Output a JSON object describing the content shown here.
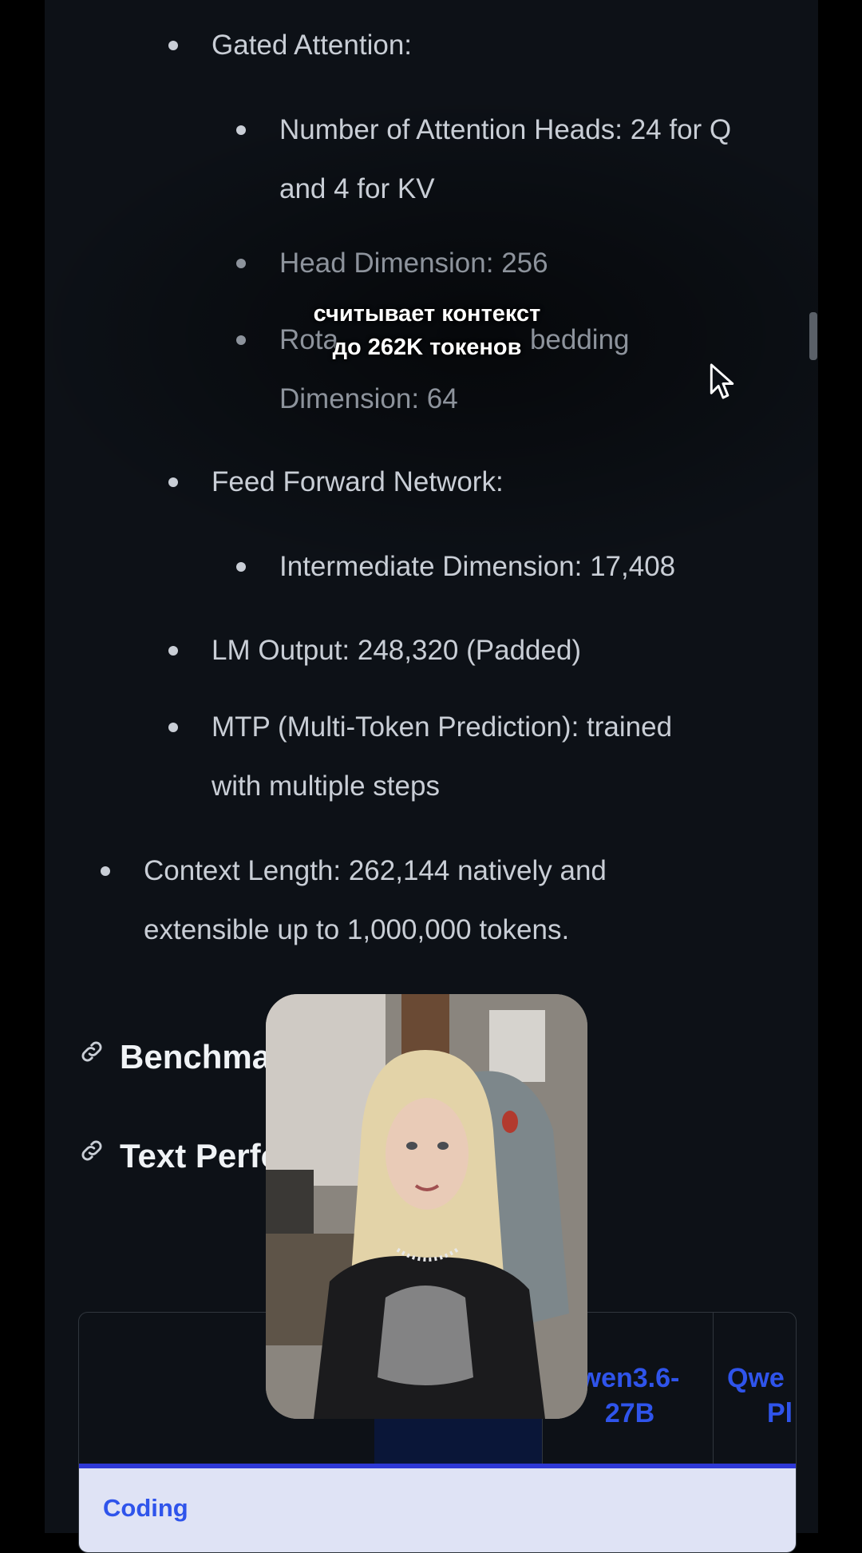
{
  "spec_list": {
    "gated_attention": "Gated Attention:",
    "heads_line1": "Number of Attention Heads: 24 for Q",
    "heads_line2": "and 4 for KV",
    "head_dim": "Head Dimension: 256",
    "rope_part1": "Rota",
    "rope_part2": "bedding",
    "rope_line2": "Dimension: 64",
    "ffn": "Feed Forward Network:",
    "intermediate": "Intermediate Dimension: 17,408",
    "lm_output": "LM Output: 248,320 (Padded)",
    "mtp_line1": "MTP (Multi-Token Prediction): trained",
    "mtp_line2": "with multiple steps",
    "context_line1": "Context Length: 262,144 natively and",
    "context_line2": "extensible up to 1,000,000 tokens."
  },
  "headings": {
    "benchmark": "Benchma",
    "text_perf": "Text Perfo"
  },
  "subtitle": {
    "line1": "считывает контекст",
    "line2": "до 262K токенов"
  },
  "table": {
    "col1_line1": "wen3.6-",
    "col1_line2": "27B",
    "col2_line1": "Qwe",
    "col2_line2": "Pl",
    "category": "Coding"
  },
  "colors": {
    "background": "#0d1117",
    "text": "#c9ced6",
    "heading": "#f0f3f6",
    "link_blue": "#2f54eb",
    "accent_line": "#2e38d6"
  },
  "icons": [
    "link-icon",
    "cursor-arrow-icon"
  ]
}
